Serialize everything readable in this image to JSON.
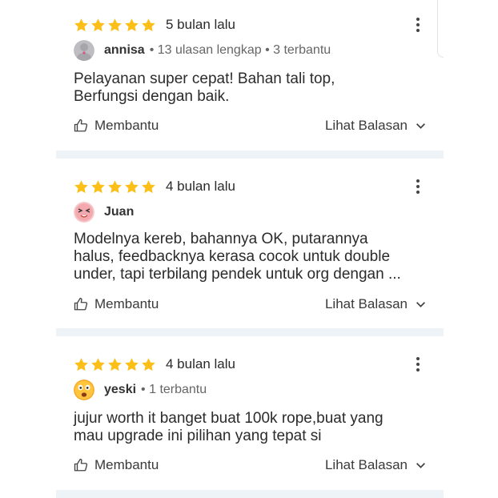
{
  "reviews": [
    {
      "rating": 5,
      "time": "5 bulan lalu",
      "username": "annisa",
      "meta": "• 13 ulasan lengkap • 3 terbantu",
      "text_lines": [
        "Pelayanan super cepat! Bahan tali top,",
        "Berfungsi dengan baik."
      ],
      "helpful_label": "Membantu",
      "replies_label": "Lihat Balasan",
      "avatar_icon": "default-avatar-icon"
    },
    {
      "rating": 5,
      "time": "4 bulan lalu",
      "username": "Juan",
      "meta": "",
      "text_lines": [
        "Modelnya kereb, bahannya OK, putarannya",
        "halus, feedbacknya kerasa cocok untuk double",
        "under, tapi terbilang pendek untuk org dengan ..."
      ],
      "helpful_label": "Membantu",
      "replies_label": "Lihat Balasan",
      "avatar_icon": "pink-face-avatar-icon"
    },
    {
      "rating": 5,
      "time": "4 bulan lalu",
      "username": "yeski",
      "meta": "• 1 terbantu",
      "text_lines": [
        "jujur worth it banget buat 100k rope,buat yang",
        "mau upgrade ini pilihan yang tepat si"
      ],
      "helpful_label": "Membantu",
      "replies_label": "Lihat Balasan",
      "avatar_icon": "surprised-emoji-avatar-icon"
    }
  ],
  "colors": {
    "star": "#fbbf17",
    "separator": "#eef3f8",
    "icon": "#444444"
  }
}
